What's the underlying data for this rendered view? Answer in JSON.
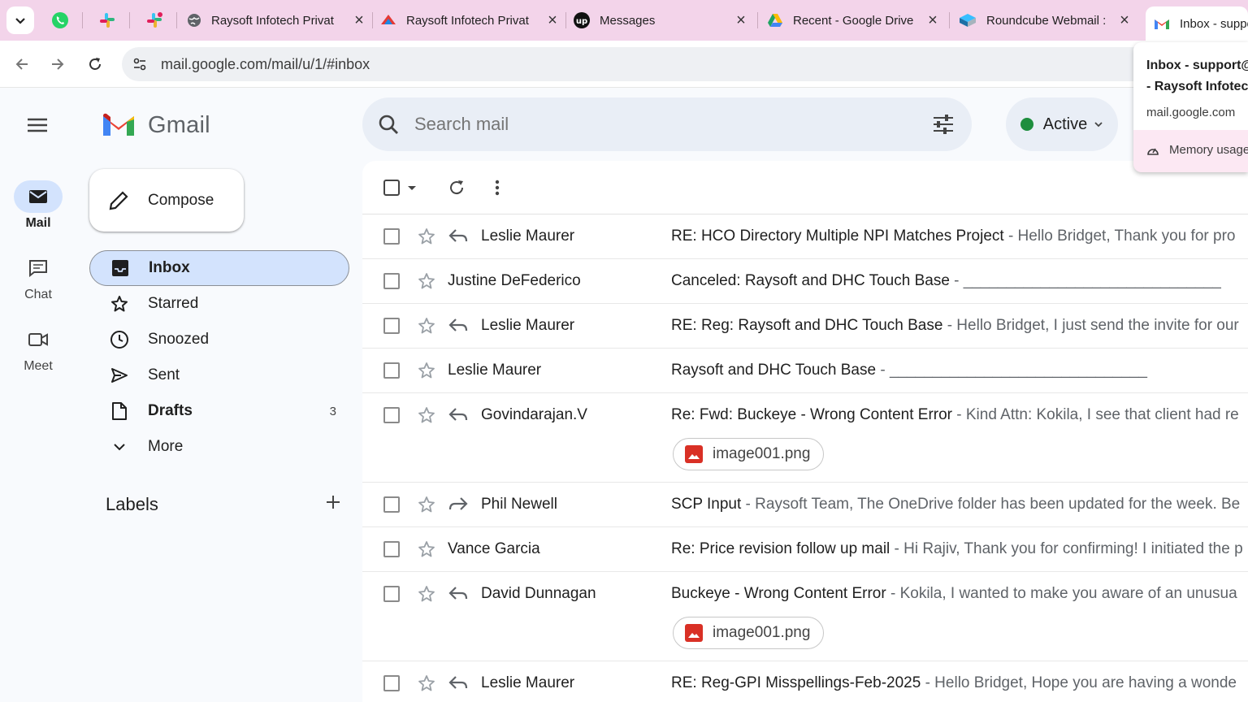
{
  "browser": {
    "tabs": [
      {
        "title": "Raysoft Infotech Privat",
        "icon": "globe-icon"
      },
      {
        "title": "Raysoft Infotech Privat",
        "icon": "raysoft-logo-icon"
      },
      {
        "title": "Messages",
        "icon": "upwork-icon"
      },
      {
        "title": "Recent - Google Drive",
        "icon": "google-drive-icon"
      },
      {
        "title": "Roundcube Webmail :",
        "icon": "roundcube-icon"
      },
      {
        "title": "Inbox - suppo",
        "icon": "gmail-icon"
      }
    ],
    "pinned_tabs": [
      "whatsapp-icon",
      "slack-icon",
      "slack-icon"
    ],
    "url": "mail.google.com/mail/u/1/#inbox",
    "hover_card": {
      "title_line1": "Inbox - support@",
      "title_line2": "- Raysoft Infotech",
      "domain": "mail.google.com",
      "memory": "Memory usage"
    }
  },
  "rail": {
    "mail": "Mail",
    "chat": "Chat",
    "meet": "Meet"
  },
  "header": {
    "app_name": "Gmail",
    "search_placeholder": "Search mail",
    "status": "Active",
    "status_color": "#1e8e3e"
  },
  "nav": {
    "compose": "Compose",
    "items": [
      {
        "label": "Inbox",
        "icon": "inbox-icon",
        "count": ""
      },
      {
        "label": "Starred",
        "icon": "star-icon",
        "count": ""
      },
      {
        "label": "Snoozed",
        "icon": "clock-icon",
        "count": ""
      },
      {
        "label": "Sent",
        "icon": "send-icon",
        "count": ""
      },
      {
        "label": "Drafts",
        "icon": "draft-icon",
        "count": "3"
      },
      {
        "label": "More",
        "icon": "chevron-down-icon",
        "count": ""
      }
    ],
    "labels_title": "Labels"
  },
  "emails": [
    {
      "sender": "Leslie Maurer",
      "status_icon": "reply",
      "subject": "RE: HCO Directory Multiple NPI Matches Project",
      "snippet": " - Hello Bridget, Thank you for pro",
      "attachment": ""
    },
    {
      "sender": "Justine DeFederico",
      "status_icon": "",
      "subject": "Canceled: Raysoft and DHC Touch Base",
      "snippet": " - ______________________________",
      "attachment": ""
    },
    {
      "sender": "Leslie Maurer",
      "status_icon": "reply",
      "subject": "RE: Reg: Raysoft and DHC Touch Base",
      "snippet": " - Hello Bridget, I just send the invite for our",
      "attachment": ""
    },
    {
      "sender": "Leslie Maurer",
      "status_icon": "",
      "subject": "Raysoft and DHC Touch Base",
      "snippet": " - ______________________________",
      "attachment": ""
    },
    {
      "sender": "Govindarajan.V",
      "status_icon": "reply",
      "subject": "Re: Fwd: Buckeye - Wrong Content Error",
      "snippet": " - Kind Attn: Kokila, I see that client had re",
      "attachment": "image001.png"
    },
    {
      "sender": "Phil Newell",
      "status_icon": "forward",
      "subject": "SCP Input",
      "snippet": " - Raysoft Team, The OneDrive folder has been updated for the week. Be",
      "attachment": ""
    },
    {
      "sender": "Vance Garcia",
      "status_icon": "",
      "subject": "Re: Price revision follow up mail",
      "snippet": " - Hi Rajiv, Thank you for confirming! I initiated the p",
      "attachment": ""
    },
    {
      "sender": "David Dunnagan",
      "status_icon": "reply",
      "subject": "Buckeye - Wrong Content Error",
      "snippet": " - Kokila, I wanted to make you aware of an unusua",
      "attachment": "image001.png"
    },
    {
      "sender": "Leslie Maurer",
      "status_icon": "reply",
      "subject": "RE: Reg-GPI Misspellings-Feb-2025",
      "snippet": " - Hello Bridget, Hope you are having a wonde",
      "attachment": ""
    }
  ]
}
